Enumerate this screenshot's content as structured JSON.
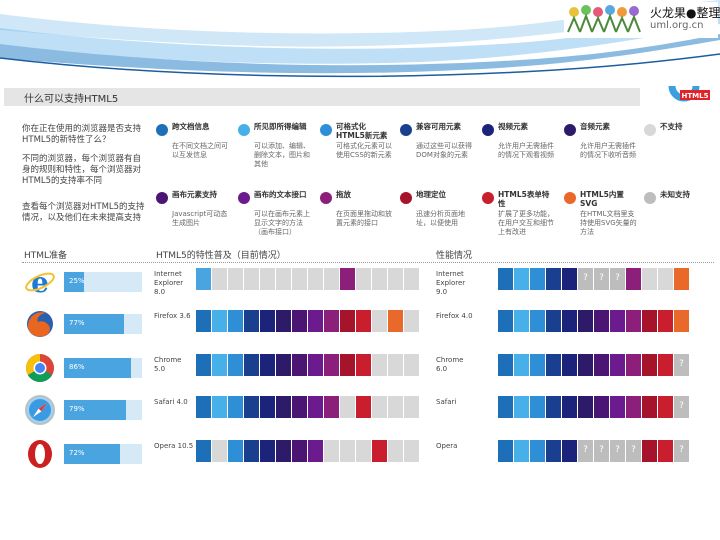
{
  "logo": {
    "text": "火龙果●整理",
    "url": "uml.org.cn"
  },
  "title": "什么可以支持HTML5",
  "html5_badge": "HTML5",
  "intro": {
    "q1": "你在正在使用的浏览器是否支持HTML5的新特性了么？",
    "p1": "不同的浏览器，每个浏览器有自身的规则和特性，每个浏览器对HTML5的支持率不同",
    "p2": "查看每个浏览器对HTML5的支持情况，以及他们在未来提高支持"
  },
  "legend": [
    {
      "title": "跨文档信息",
      "desc": "在不同文档之间可以互发信息",
      "color": "#1d70b8"
    },
    {
      "title": "所见即所得编辑",
      "desc": "可以添加、编辑、删除文本，图片和其他",
      "color": "#47b0e8"
    },
    {
      "title": "可格式化HTML5新元素",
      "desc": "可格式化元素可以使用CSS的新元素",
      "color": "#2f8fd6"
    },
    {
      "title": "兼容可用元素",
      "desc": "通过这些可以获得DOM对象的元素",
      "color": "#1a3f8f"
    },
    {
      "title": "视频元素",
      "desc": "允许用户无需插件的情况下观看视频",
      "color": "#1c237a"
    },
    {
      "title": "音频元素",
      "desc": "允许用户无需插件的情况下收听音频",
      "color": "#2d1b69"
    },
    {
      "title": "不支持",
      "desc": "",
      "color": "#d8d8d8"
    },
    {
      "title": "画布元素支持",
      "desc": "Javascript可动态生成图片",
      "color": "#4b1574"
    },
    {
      "title": "画布的文本接口",
      "desc": "可以在画布元素上显示文字的方法（画布接口）",
      "color": "#6b1b8e"
    },
    {
      "title": "拖放",
      "desc": "在页面里拖动和放置元素的接口",
      "color": "#8b1f7a"
    },
    {
      "title": "地理定位",
      "desc": "迅速分析页面地址，以便使用",
      "color": "#a5142b"
    },
    {
      "title": "HTML5表单特性",
      "desc": "扩展了更多功能，在用户交互和细节上有改进",
      "color": "#c81e2d"
    },
    {
      "title": "HTML5内置SVG",
      "desc": "在HTML文档里支持使用SVG矢量的方法",
      "color": "#e8692a"
    },
    {
      "title": "未知支持",
      "desc": "",
      "color": "#bdbdbd"
    }
  ],
  "sections": {
    "ready": "HTML准备",
    "features_now": "HTML5的特性普及（目前情况）",
    "performance": "性能情况"
  },
  "browsers": [
    {
      "icon": "ie-icon",
      "name": "Internet Explorer 8.0",
      "name2": "Internet Explorer 9.0",
      "percent_label": "25%",
      "percent": 25
    },
    {
      "icon": "firefox-icon",
      "name": "Firefox 3.6",
      "name2": "Firefox 4.0",
      "percent_label": "77%",
      "percent": 77
    },
    {
      "icon": "chrome-icon",
      "name": "Chrome 5.0",
      "name2": "Chrome 6.0",
      "percent_label": "86%",
      "percent": 86
    },
    {
      "icon": "safari-icon",
      "name": "Safari 4.0",
      "name2": "Safari",
      "percent_label": "79%",
      "percent": 79
    },
    {
      "icon": "opera-icon",
      "name": "Opera 10.5",
      "name2": "Opera",
      "percent_label": "72%",
      "percent": 72
    }
  ],
  "colors": {
    "bg": "#ffffff",
    "cell_blue1": "#1d70b8",
    "cell_blue2": "#47b0e8",
    "cell_gray": "#d8d8d8",
    "cell_unknown": "#bdbdbd",
    "progress_fill": "#4aa4e0"
  },
  "cells": {
    "left": [
      [
        "#4aa4e0",
        "#d8d8d8",
        "#d8d8d8",
        "#d8d8d8",
        "#d8d8d8",
        "#d8d8d8",
        "#d8d8d8",
        "#d8d8d8",
        "#d8d8d8",
        "#8b1f7a",
        "#d8d8d8",
        "#d8d8d8",
        "#d8d8d8",
        "#d8d8d8"
      ],
      [
        "#1d70b8",
        "#47b0e8",
        "#2f8fd6",
        "#1a3f8f",
        "#1c237a",
        "#2d1b69",
        "#4b1574",
        "#6b1b8e",
        "#8b1f7a",
        "#a5142b",
        "#c81e2d",
        "#d8d8d8",
        "#e8692a",
        "#d8d8d8"
      ],
      [
        "#1d70b8",
        "#47b0e8",
        "#2f8fd6",
        "#1a3f8f",
        "#1c237a",
        "#2d1b69",
        "#4b1574",
        "#6b1b8e",
        "#8b1f7a",
        "#a5142b",
        "#c81e2d",
        "#d8d8d8",
        "#d8d8d8",
        "#d8d8d8"
      ],
      [
        "#1d70b8",
        "#47b0e8",
        "#2f8fd6",
        "#1a3f8f",
        "#1c237a",
        "#2d1b69",
        "#4b1574",
        "#6b1b8e",
        "#8b1f7a",
        "#d8d8d8",
        "#c81e2d",
        "#d8d8d8",
        "#d8d8d8",
        "#d8d8d8"
      ],
      [
        "#1d70b8",
        "#d8d8d8",
        "#2f8fd6",
        "#1a3f8f",
        "#1c237a",
        "#2d1b69",
        "#4b1574",
        "#6b1b8e",
        "#d8d8d8",
        "#d8d8d8",
        "#d8d8d8",
        "#c81e2d",
        "#d8d8d8",
        "#d8d8d8"
      ]
    ],
    "right": [
      [
        "#1d70b8",
        "#47b0e8",
        "#2f8fd6",
        "#1a3f8f",
        "#1c237a",
        "?",
        "?",
        "?",
        "#8b1f7a",
        "#d8d8d8",
        "#d8d8d8",
        "#e8692a"
      ],
      [
        "#1d70b8",
        "#47b0e8",
        "#2f8fd6",
        "#1a3f8f",
        "#1c237a",
        "#2d1b69",
        "#4b1574",
        "#6b1b8e",
        "#8b1f7a",
        "#a5142b",
        "#c81e2d",
        "#e8692a"
      ],
      [
        "#1d70b8",
        "#47b0e8",
        "#2f8fd6",
        "#1a3f8f",
        "#1c237a",
        "#2d1b69",
        "#4b1574",
        "#6b1b8e",
        "#8b1f7a",
        "#a5142b",
        "#c81e2d",
        "?"
      ],
      [
        "#1d70b8",
        "#47b0e8",
        "#2f8fd6",
        "#1a3f8f",
        "#1c237a",
        "#2d1b69",
        "#4b1574",
        "#6b1b8e",
        "#8b1f7a",
        "#a5142b",
        "#c81e2d",
        "?"
      ],
      [
        "#1d70b8",
        "#47b0e8",
        "#2f8fd6",
        "#1a3f8f",
        "#1c237a",
        "?",
        "?",
        "?",
        "?",
        "#a5142b",
        "#c81e2d",
        "?"
      ]
    ]
  }
}
